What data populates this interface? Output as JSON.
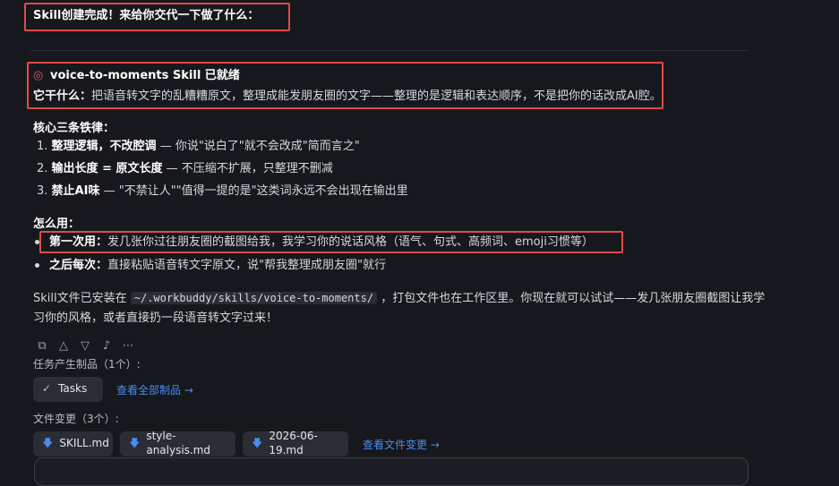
{
  "header": {
    "text": "Skill创建完成！来给你交代一下做了什么："
  },
  "skill": {
    "icon": "target-icon",
    "title": "voice-to-moments Skill 已就绪",
    "desc_label": "它干什么：",
    "desc_text": "把语音转文字的乱糟糟原文，整理成能发朋友圈的文字——整理的是逻辑和表达顺序，不是把你的话改成AI腔。"
  },
  "rules": {
    "heading": "核心三条铁律：",
    "items": [
      {
        "num": "1.",
        "bold": "整理逻辑，不改腔调",
        "text": " — 你说\"说白了\"就不会改成\"简而言之\""
      },
      {
        "num": "2.",
        "bold": "输出长度 = 原文长度",
        "text": " — 不压缩不扩展，只整理不删减"
      },
      {
        "num": "3.",
        "bold": "禁止AI味",
        "text": " — \"不禁让人\"\"值得一提的是\"这类词永远不会出现在输出里"
      }
    ]
  },
  "howto": {
    "heading": "怎么用：",
    "items": [
      {
        "bold": "第一次用：",
        "text": "发几张你过往朋友圈的截图给我，我学习你的说话风格（语气、句式、高频词、emoji习惯等）"
      },
      {
        "bold": "之后每次：",
        "text": "直接粘贴语音转文字原文，说\"帮我整理成朋友圈\"就行"
      }
    ]
  },
  "install": {
    "prefix": "Skill文件已安装在 ",
    "path": "~/.workbuddy/skills/voice-to-moments/",
    "suffix": " ，打包文件也在工作区里。你现在就可以试试——发几张朋友圈截图让我学",
    "line2": "习你的风格，或者直接扔一段语音转文字过来！"
  },
  "actions": [
    "copy-icon",
    "thumbs-up-icon",
    "thumbs-down-icon",
    "speaker-icon",
    "more-icon"
  ],
  "artifacts": {
    "label": "任务产生制品（1个）:",
    "tasks_label": "Tasks",
    "view_all": "查看全部制品 →"
  },
  "files": {
    "label": "文件变更（3个）:",
    "items": [
      "SKILL.md",
      "style-analysis.md",
      "2026-06-19.md"
    ],
    "view_changes": "查看文件变更 →"
  },
  "colors": {
    "background": "#16181d",
    "highlight": "#e24a4a",
    "link": "#4a8cf0"
  }
}
